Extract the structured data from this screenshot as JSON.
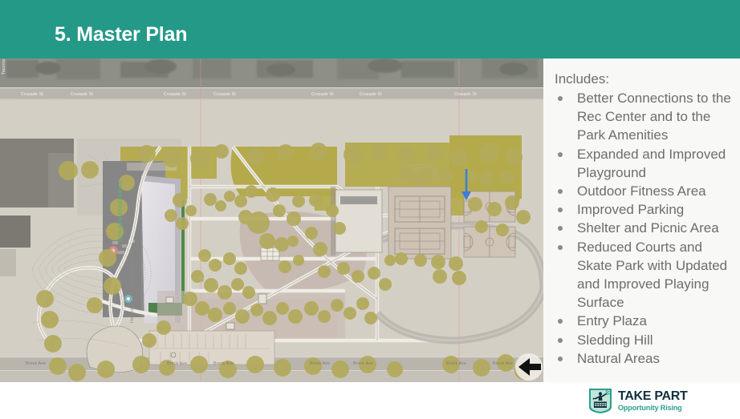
{
  "header": {
    "title": "5. Master Plan",
    "bg_color": "#259987",
    "text_color": "#ffffff"
  },
  "sidebar": {
    "intro_label": "Includes:",
    "text_color": "#6d6d6d",
    "bg_color": "#f8f8f6",
    "bullet_color": "#8a8a8a",
    "items": [
      {
        "label": "Better Connections to the Rec Center and to the Park Amenities"
      },
      {
        "label": "Expanded and Improved Playground"
      },
      {
        "label": "Outdoor Fitness Area"
      },
      {
        "label": "Improved Parking"
      },
      {
        "label": "Shelter and Picnic Area"
      },
      {
        "label": "Reduced Courts and Skate Park with Updated and Improved Playing Surface"
      },
      {
        "label": "Entry Plaza"
      },
      {
        "label": "Sledding Hill"
      },
      {
        "label": "Natural Areas"
      }
    ]
  },
  "map": {
    "type": "aerial-site-master-plan",
    "colors": {
      "aerial_base": "#cfcac1",
      "pavement": "#d9d5cd",
      "roof_dark": "#8d8d8d",
      "vegetation_green": "#b4aa4b",
      "tree_canopy": "#b3aa5c",
      "plaza_mauve": "#c3b6ae",
      "court_tan": "#cdc2b4",
      "turf_green": "#4e8a48",
      "path_white": "#ece9e2",
      "parcel_line": "#e88a8a",
      "callout_arrow": "#3b7fd4"
    },
    "street_labels_top": [
      "Crusade St",
      "Crusade St",
      "Crusade St",
      "Crusade St",
      "Crusade St",
      "Crusade St",
      "Crusade St"
    ],
    "street_labels_bottom": [
      "Brock Ave",
      "Brock Ave",
      "Brock Ave",
      "Brock Ave",
      "Brock Ave",
      "Brock Ave",
      "Brock Ave"
    ],
    "street_label_left": "Tacoma",
    "poi_labels": [
      {
        "text": "HEILMAN RECREATION",
        "kind": "vertical-green"
      },
      {
        "text": "Heilmann Community Center",
        "kind": "vertical-gray"
      }
    ],
    "north_arrow": {
      "direction": "left",
      "icon": "arrow-left-icon",
      "fill": "#1a1a1a"
    },
    "callout_arrow": {
      "direction": "down",
      "icon": "arrow-down-icon",
      "color": "#3b7fd4"
    }
  },
  "footer": {
    "logo": {
      "mark_name": "spirit-of-detroit-badge-icon",
      "title": "TAKE PART",
      "subtitle": "Opportunity Rising",
      "title_color": "#13303d",
      "subtitle_color": "#2aa08c"
    }
  }
}
